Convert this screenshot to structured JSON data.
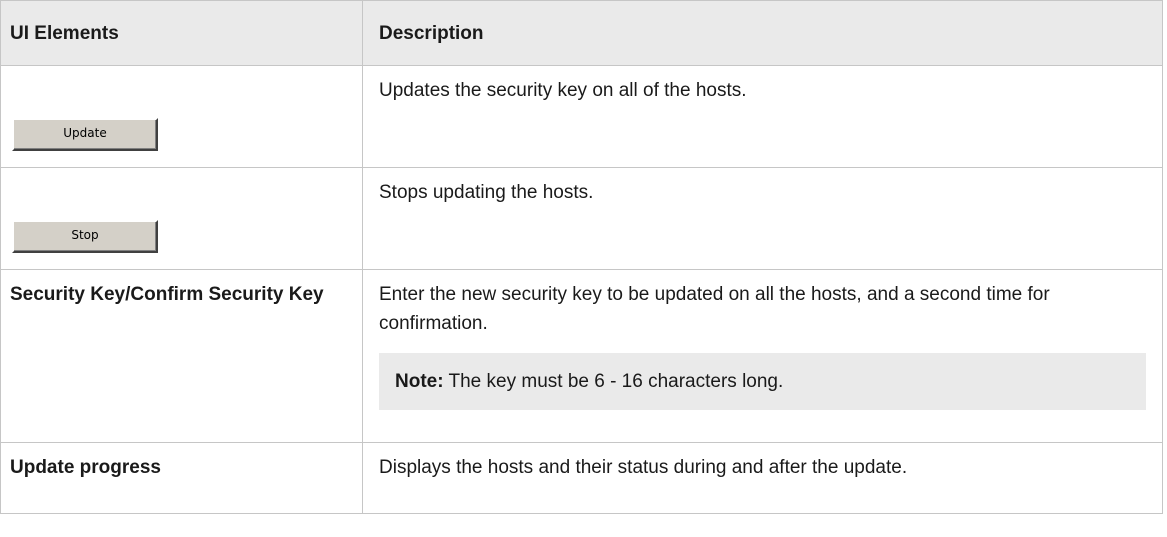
{
  "table": {
    "headers": {
      "elements": "UI Elements",
      "description": "Description"
    },
    "rows": [
      {
        "element_button": "Update",
        "description": "Updates the security key on all of the hosts."
      },
      {
        "element_button": "Stop",
        "description": "Stops updating the hosts."
      },
      {
        "element_label": "Security Key/Confirm Security Key",
        "description": "Enter the new security key to be updated on all the hosts, and a second time for confirmation.",
        "note_label": "Note:",
        "note_text": " The key must be 6 - 16 characters long."
      },
      {
        "element_label": "Update progress",
        "description": "Displays the hosts and their status during and after the update."
      }
    ]
  }
}
